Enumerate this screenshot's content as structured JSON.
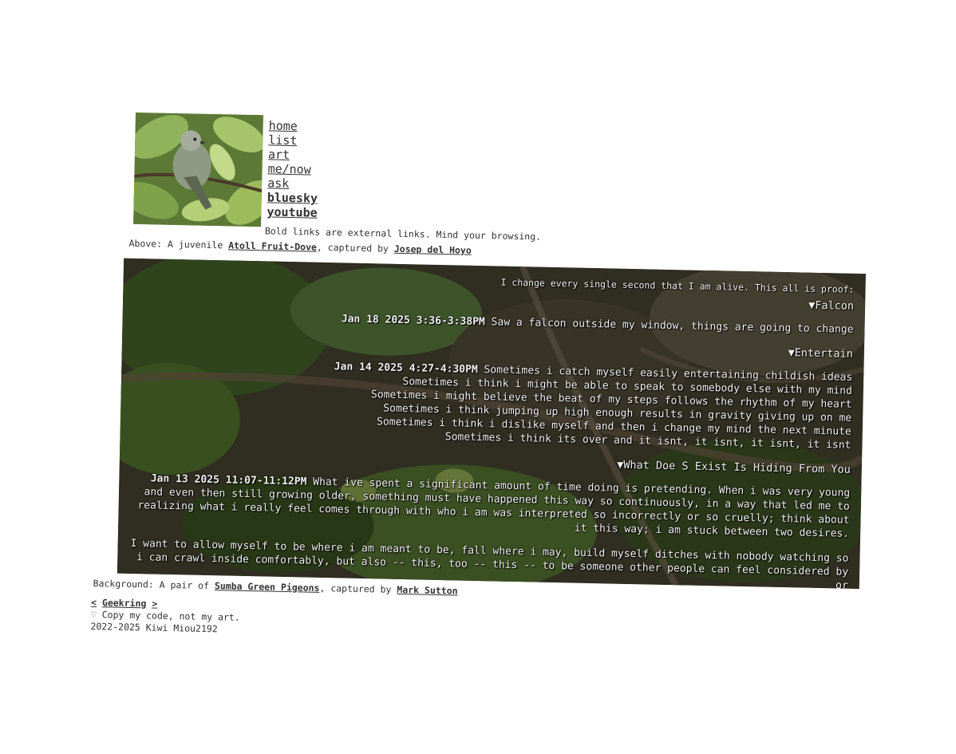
{
  "nav": {
    "items": [
      {
        "label": "home",
        "external": false
      },
      {
        "label": "list",
        "external": false
      },
      {
        "label": "art",
        "external": false
      },
      {
        "label": "me/now",
        "external": false
      },
      {
        "label": "ask",
        "external": false
      },
      {
        "label": "bluesky",
        "external": true
      },
      {
        "label": "youtube",
        "external": true
      }
    ],
    "external_note": "Bold links are external links. Mind your browsing."
  },
  "header_caption": {
    "prefix": "Above: A juvenile ",
    "species": "Atoll Fruit-Dove",
    "middle": ", captured by ",
    "photographer": "Josep del Hoyo"
  },
  "log": {
    "intro": "I change every single second that I am alive. This all is proof:",
    "sections": [
      {
        "title": "▼Falcon",
        "date": "Jan 18 2025 3:36-3:38PM",
        "lines": [
          "Saw a falcon outside my window, things are going to change"
        ]
      },
      {
        "title": "▼Entertain",
        "date": "Jan 14 2025 4:27-4:30PM",
        "lines": [
          "Sometimes i catch myself easily entertaining childish ideas",
          "Sometimes i think i might be able to speak to somebody else with my mind",
          "Sometimes i might believe the beat of my steps follows the rhythm of my heart",
          "Sometimes i think jumping up high enough results in gravity giving up on me",
          "Sometimes i think i dislike myself and then i change my mind the next minute",
          "Sometimes i think its over and it isnt, it isnt, it isnt, it isnt"
        ]
      },
      {
        "title": "▼What Doe S Exist Is Hiding From You",
        "date": "Jan 13 2025 11:07-11:12PM",
        "paragraphs": [
          "What ive spent a significant amount of time doing is pretending. When i was very young and even then still growing older, something must have happened this way so continuously, in a way that led me to realizing what i really feel comes through with who i am was interpreted so incorrectly or so cruelly; think about it this way; i am stuck between two desires.",
          "I want to allow myself to be where i am meant to be, fall where i may, build myself ditches with nobody watching so i can crawl inside comfortably, but also -- this, too -- this -- to be someone other people can feel considered by or"
        ]
      }
    ]
  },
  "background_caption": {
    "prefix": "Background: A pair of ",
    "species": "Sumba Green Pigeons",
    "middle": ", captured by ",
    "photographer": "Mark Sutton"
  },
  "footer": {
    "prev": "<",
    "ring": "Geekring",
    "next": ">",
    "heart": "♡",
    "copy": "Copy my code, not my art.",
    "credit": "2022-2025 Kiwi Miou2192"
  },
  "colors": {
    "text": "#333333",
    "panel_text": "#f2f2f2",
    "foliage": "#6f8a44"
  },
  "icons": {
    "collapse": "triangle-down-icon",
    "heart": "heart-outline-icon"
  }
}
